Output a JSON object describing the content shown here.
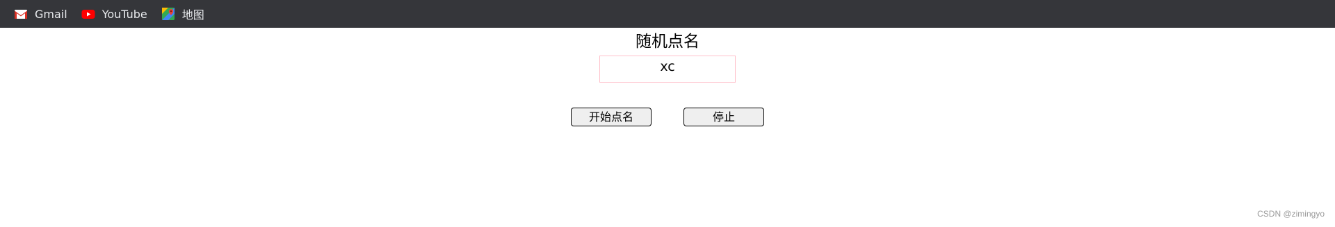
{
  "bookmarks": [
    {
      "label": "Gmail",
      "icon": "gmail-icon"
    },
    {
      "label": "YouTube",
      "icon": "youtube-icon"
    },
    {
      "label": "地图",
      "icon": "maps-icon"
    }
  ],
  "page": {
    "title": "随机点名",
    "current_name": "xc",
    "start_button": "开始点名",
    "stop_button": "停止"
  },
  "watermark": "CSDN @zimingyo",
  "colors": {
    "bookmark_bar_bg": "#35363a",
    "name_box_border": "#ffc0cb"
  }
}
